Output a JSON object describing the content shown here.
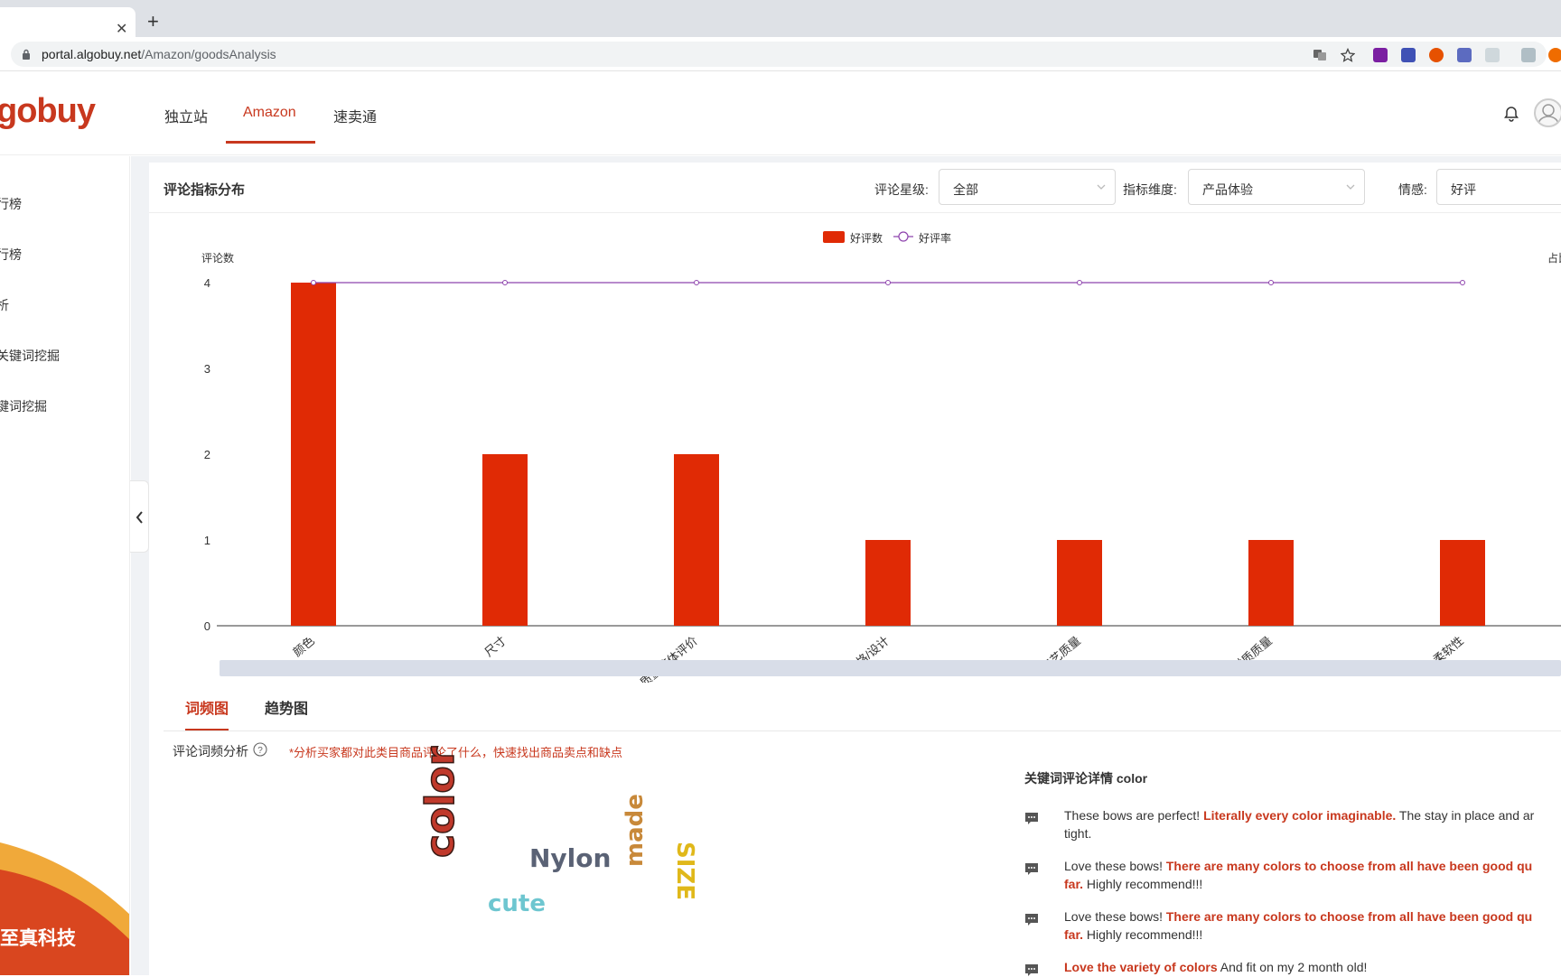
{
  "browser": {
    "url_host": "portal.algobuy.net",
    "url_path": "/Amazon/goodsAnalysis"
  },
  "app": {
    "logo": "gobuy",
    "nav": [
      {
        "label": "独立站"
      },
      {
        "label": "Amazon"
      },
      {
        "label": "速卖通"
      }
    ]
  },
  "sidebar": {
    "items": [
      {
        "label": "行榜"
      },
      {
        "label": "行榜"
      },
      {
        "label": "析"
      },
      {
        "label": "关键词挖掘"
      },
      {
        "label": "键词挖掘"
      }
    ],
    "banner_text": "至真科技"
  },
  "panel": {
    "title": "评论指标分布",
    "filters": {
      "star_label": "评论星级:",
      "star_value": "全部",
      "dimension_label": "指标维度:",
      "dimension_value": "产品体验",
      "sentiment_label": "情感:",
      "sentiment_value": "好评"
    }
  },
  "chart_data": {
    "type": "bar",
    "categories": [
      "颜色",
      "尺寸",
      "质量整体评价",
      "风格/设计",
      "工艺质量",
      "材质质量",
      "柔软性"
    ],
    "series": [
      {
        "name": "好评数",
        "type": "bar",
        "values": [
          4,
          2,
          2,
          1,
          1,
          1,
          1
        ],
        "color": "#e02a05"
      },
      {
        "name": "好评率",
        "type": "line",
        "values": [
          100,
          100,
          100,
          100,
          100,
          100,
          100
        ],
        "color": "#8e44ad"
      }
    ],
    "ylabel": "评论数",
    "ylabel_right": "占比",
    "yticks": [
      0,
      1,
      2,
      3,
      4
    ],
    "ylim": [
      0,
      4
    ],
    "legend_position": "top-center"
  },
  "tabs": [
    {
      "label": "词频图"
    },
    {
      "label": "趋势图"
    }
  ],
  "wordfreq": {
    "label": "评论词频分析",
    "note": "*分析买家都对此类目商品评论了什么，快速找出商品卖点和缺点",
    "words": [
      {
        "text": "color",
        "color": "#c0392b"
      },
      {
        "text": "Nylon",
        "color": "#5a6275"
      },
      {
        "text": "made",
        "color": "#c8893a"
      },
      {
        "text": "SIZE",
        "color": "#e0b81a"
      },
      {
        "text": "cute",
        "color": "#6ec6d0"
      }
    ]
  },
  "keyword_detail": {
    "title": "关键词评论详情 color",
    "reviews": [
      {
        "before": "These bows are perfect! ",
        "highlight": "Literally every color imaginable.",
        "after": " The stay in place and ar",
        "line2": "tight."
      },
      {
        "before": "Love these bows! ",
        "highlight": "There are many colors to choose from all have been good qu",
        "after": "",
        "line2_hl": "far.",
        "line2": " Highly recommend!!!"
      },
      {
        "before": "Love these bows! ",
        "highlight": "There are many colors to choose from all have been good qu",
        "after": "",
        "line2_hl": "far.",
        "line2": " Highly recommend!!!"
      },
      {
        "before": "",
        "highlight": "Love the variety of colors",
        "after": " And fit on my 2 month old!",
        "line2": ""
      }
    ]
  }
}
